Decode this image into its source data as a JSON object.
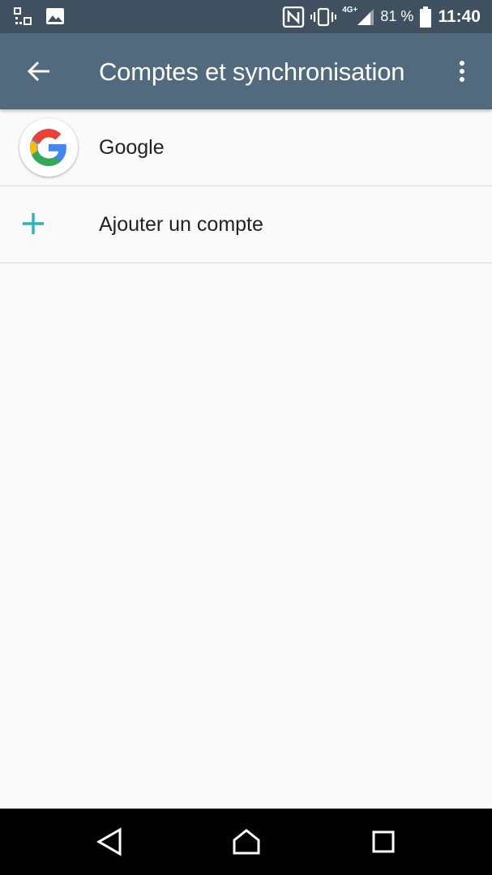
{
  "status_bar": {
    "network_type": "4G+",
    "battery_percent": "81 %",
    "time": "11:40"
  },
  "toolbar": {
    "title": "Comptes et synchronisation"
  },
  "accounts": [
    {
      "label": "Google",
      "icon": "google-logo-icon"
    },
    {
      "label": "Ajouter un compte",
      "icon": "plus-icon"
    }
  ],
  "colors": {
    "status_bar": "#3f5160",
    "toolbar": "#526a7e",
    "accent": "#2bb3b9",
    "background": "#fafafa"
  }
}
